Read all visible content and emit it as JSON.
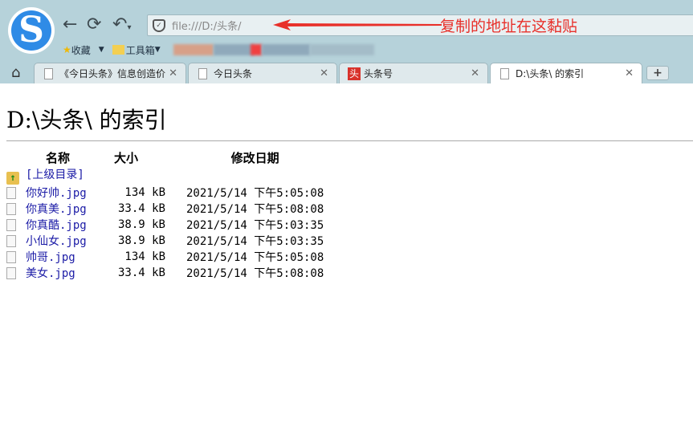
{
  "browser": {
    "address": "file:///D:/头条/",
    "annotation": "复制的地址在这黏贴",
    "bookmarks": [
      {
        "label": "收藏",
        "icon": "star-icon"
      },
      {
        "label": "工具箱",
        "icon": "folder-icon"
      }
    ],
    "tabs": [
      {
        "label": "《今日头条》信息创造价",
        "active": false
      },
      {
        "label": "今日头条",
        "active": false
      },
      {
        "label": "头条号",
        "active": false,
        "badge": "头"
      },
      {
        "label": "D:\\头条\\ 的索引",
        "active": true
      }
    ],
    "new_tab": "+"
  },
  "page": {
    "title": "D:\\头条\\ 的索引",
    "headers": {
      "name": "名称",
      "size": "大小",
      "modified": "修改日期"
    },
    "parent": "[上级目录]",
    "files": [
      {
        "name": "你好帅.jpg",
        "size": "134 kB",
        "date": "2021/5/14 下午5:05:08"
      },
      {
        "name": "你真美.jpg",
        "size": "33.4 kB",
        "date": "2021/5/14 下午5:08:08"
      },
      {
        "name": "你真酷.jpg",
        "size": "38.9 kB",
        "date": "2021/5/14 下午5:03:35"
      },
      {
        "name": "小仙女.jpg",
        "size": "38.9 kB",
        "date": "2021/5/14 下午5:03:35"
      },
      {
        "name": "帅哥.jpg",
        "size": "134 kB",
        "date": "2021/5/14 下午5:05:08"
      },
      {
        "name": "美女.jpg",
        "size": "33.4 kB",
        "date": "2021/5/14 下午5:08:08"
      }
    ]
  }
}
